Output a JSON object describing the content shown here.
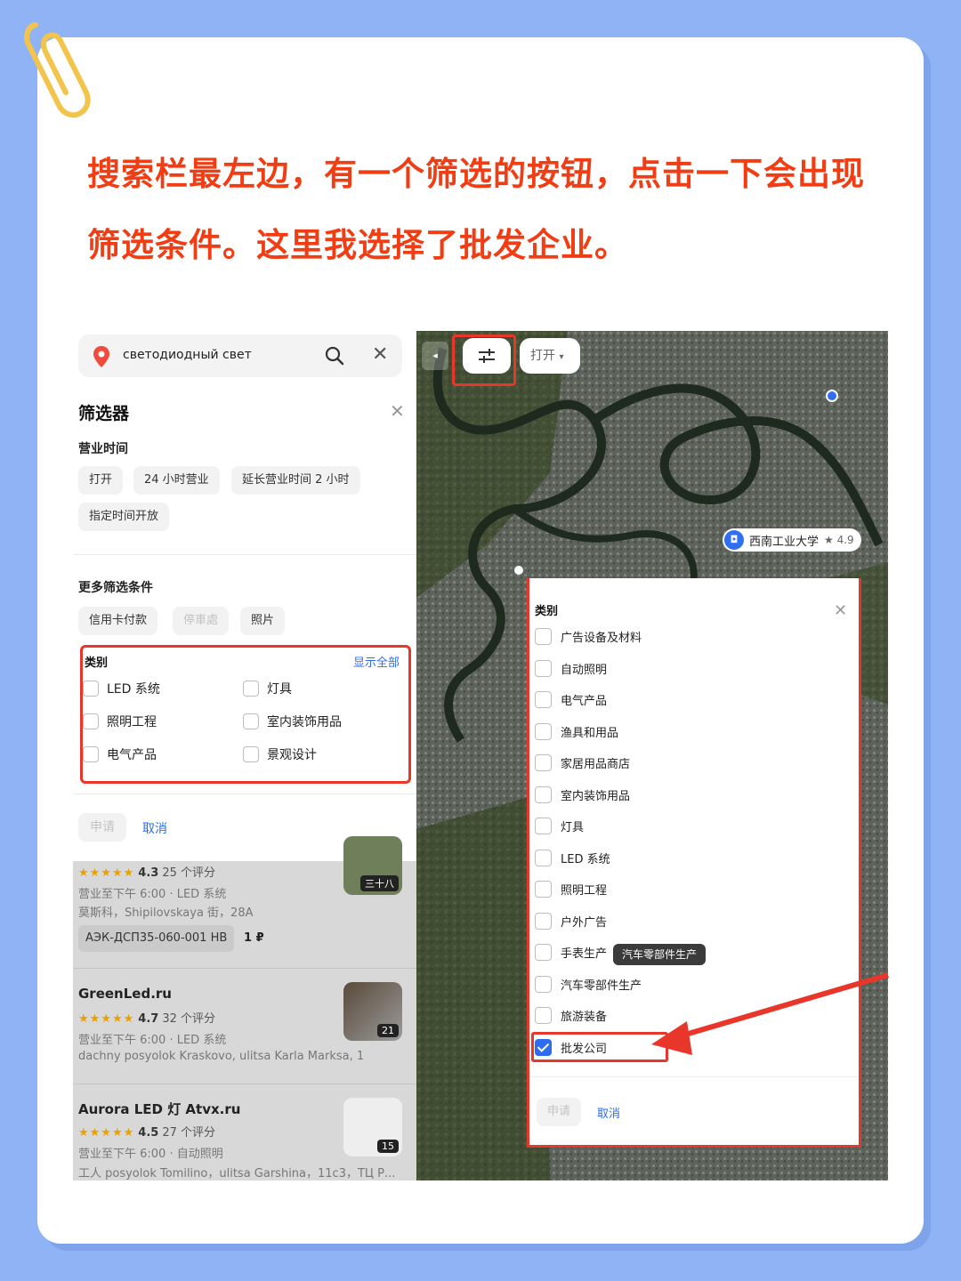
{
  "headline": "搜索栏最左边，有一个筛选的按钮，点击一下会出现筛选条件。这里我选择了批发企业。",
  "search": {
    "query": "светодиодный свет"
  },
  "filters": {
    "title": "筛选器",
    "hours_label": "营业时间",
    "hours_chips": [
      "打开",
      "24 小时营业",
      "延长营业时间 2 小时",
      "指定时间开放"
    ],
    "more_label": "更多筛选条件",
    "more_chips": [
      "信用卡付款",
      "停車處",
      "照片"
    ],
    "category_label": "类别",
    "show_all": "显示全部",
    "categories": [
      "LED 系统",
      "灯具",
      "照明工程",
      "室内装饰用品",
      "电气产品",
      "景观设计"
    ],
    "apply": "申请",
    "cancel": "取消"
  },
  "results": [
    {
      "name": "",
      "stars": "★★★★★",
      "rating": "4.3",
      "reviews": "25 个评分",
      "hours": "营业至下午 6:00 · LED 系统",
      "address": "莫斯科，Shipilovskaya 街，28A",
      "price_label": "АЭК-ДСП35-060-001 НВ",
      "price": "1 ₽",
      "thumb_text": "三十八"
    },
    {
      "name": "GreenLed.ru",
      "stars": "★★★★★",
      "rating": "4.7",
      "reviews": "32 个评分",
      "hours": "营业至下午 6:00 · LED 系统",
      "address": "dachny posyolok Kraskovo, ulitsa Karla Marksa, 1",
      "thumb_badge": "21"
    },
    {
      "name": "Aurora LED 灯 Atvx.ru",
      "stars": "★★★★★",
      "rating": "4.5",
      "reviews": "27 个评分",
      "hours": "营业至下午 6:00 · 自动照明",
      "address": "工人 posyolok Tomilino，ulitsa Garshina，11с3，ТЦ Р...",
      "thumb_badge": "15"
    }
  ],
  "map": {
    "open_label": "打开",
    "poi_name": "西南工业大学",
    "poi_rating": "★ 4.9",
    "category_title": "类别",
    "categories": [
      {
        "label": "广告设备及材料",
        "checked": false
      },
      {
        "label": "自动照明",
        "checked": false
      },
      {
        "label": "电气产品",
        "checked": false
      },
      {
        "label": "渔具和用品",
        "checked": false
      },
      {
        "label": "家居用品商店",
        "checked": false
      },
      {
        "label": "室内装饰用品",
        "checked": false
      },
      {
        "label": "灯具",
        "checked": false
      },
      {
        "label": "LED 系统",
        "checked": false
      },
      {
        "label": "照明工程",
        "checked": false
      },
      {
        "label": "户外广告",
        "checked": false
      },
      {
        "label": "手表生产",
        "checked": false
      },
      {
        "label": "汽车零部件生产",
        "checked": false
      },
      {
        "label": "旅游装备",
        "checked": false
      },
      {
        "label": "批发公司",
        "checked": true
      }
    ],
    "tooltip": "汽车零部件生产",
    "apply": "申请",
    "cancel": "取消"
  },
  "colors": {
    "accent_red": "#f03d14",
    "highlight_red": "#e8362a",
    "link_blue": "#2b6cf0",
    "background": "#8fb3f5"
  }
}
